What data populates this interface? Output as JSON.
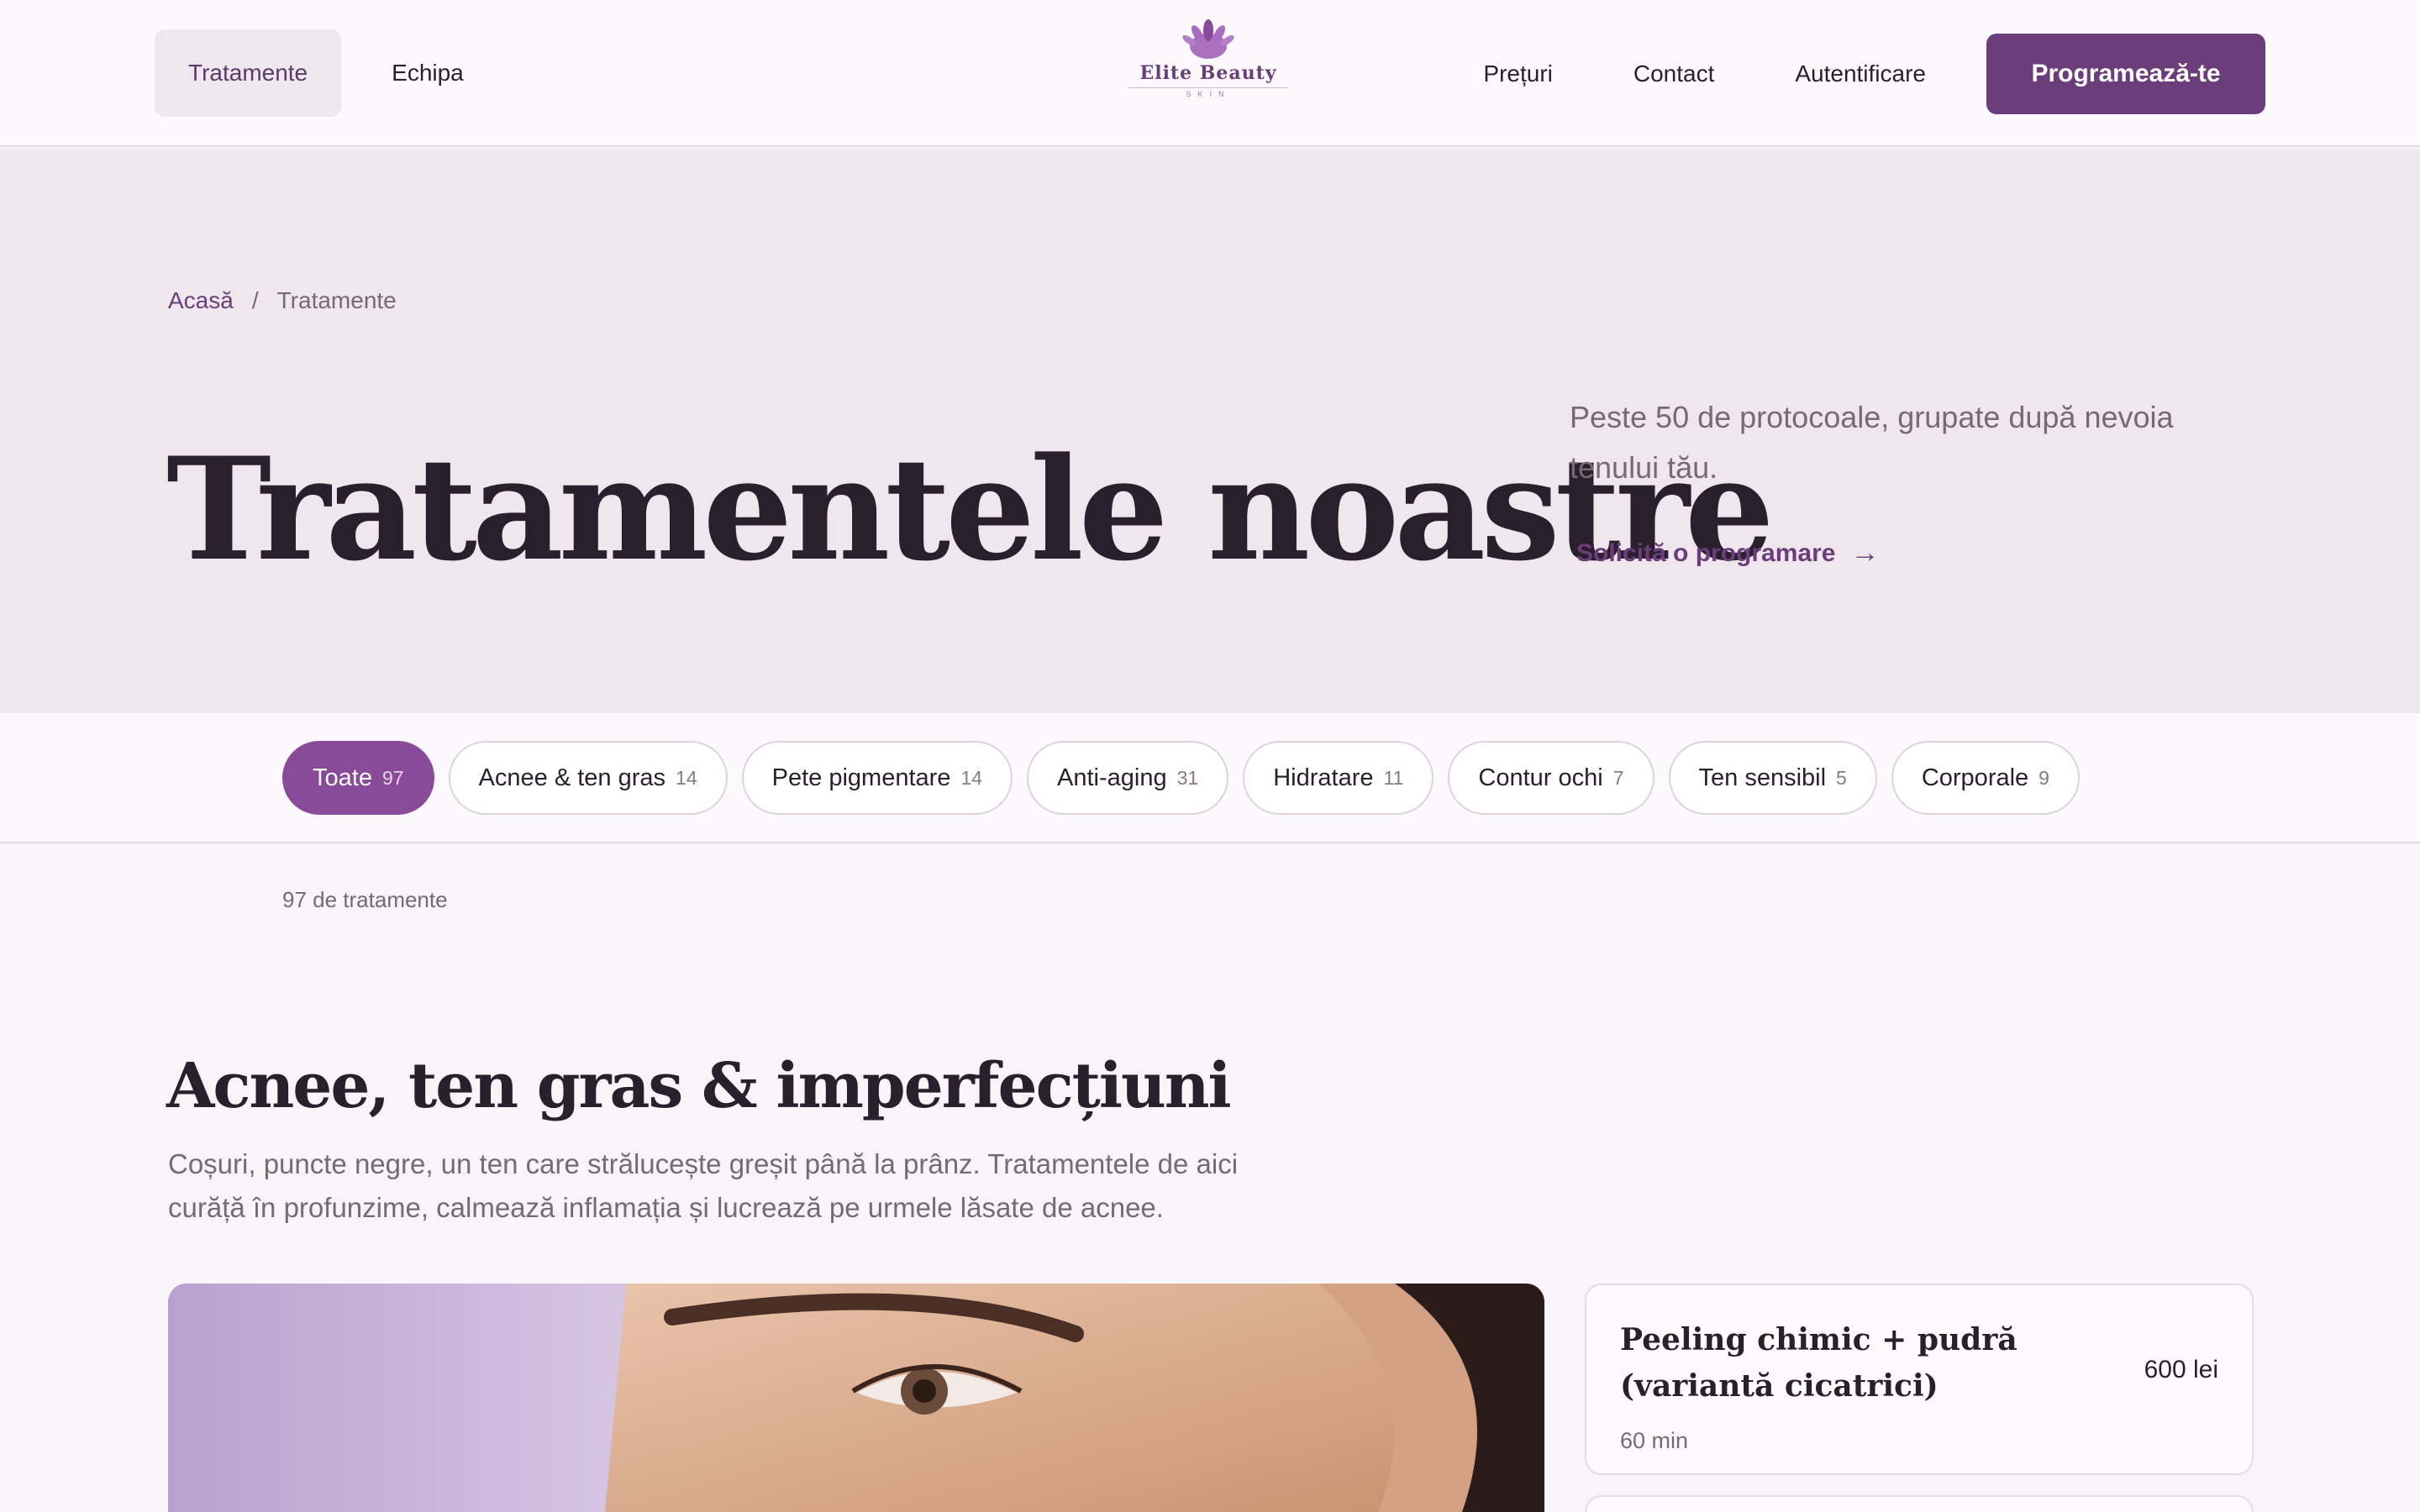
{
  "header": {
    "nav_left": [
      {
        "label": "Tratamente",
        "active": true
      },
      {
        "label": "Echipa",
        "active": false
      }
    ],
    "logo": {
      "name": "Elite Beauty",
      "sub": "SKIN",
      "icon": "lotus-icon"
    },
    "nav_right": [
      "Prețuri",
      "Contact",
      "Autentificare"
    ],
    "cta": "Programează-te"
  },
  "hero": {
    "breadcrumb": {
      "home": "Acasă",
      "separator": "/",
      "current": "Tratamente"
    },
    "title": "Tratamentele noastre",
    "description": "Peste 50 de protocoale, grupate după nevoia tenului tău.",
    "cta": "Solicită o programare",
    "cta_icon": "arrow-right-icon"
  },
  "filters": [
    {
      "label": "Toate",
      "count": "97",
      "active": true
    },
    {
      "label": "Acnee & ten gras",
      "count": "14",
      "active": false
    },
    {
      "label": "Pete pigmentare",
      "count": "14",
      "active": false
    },
    {
      "label": "Anti-aging",
      "count": "31",
      "active": false
    },
    {
      "label": "Hidratare",
      "count": "11",
      "active": false
    },
    {
      "label": "Contur ochi",
      "count": "7",
      "active": false
    },
    {
      "label": "Ten sensibil",
      "count": "5",
      "active": false
    },
    {
      "label": "Corporale",
      "count": "9",
      "active": false
    }
  ],
  "result_count": "97 de tratamente",
  "section": {
    "title": "Acnee, ten gras & imperfecțiuni",
    "description": "Coșuri, puncte negre, un ten care strălucește greșit până la prânz. Tratamentele de aici curăță în profunzime, calmează inflamația și lucrează pe urmele lăsate de acnee.",
    "treatments": [
      {
        "name": "Peeling chimic + pudră (variantă cicatrici)",
        "duration": "60 min",
        "price": "600 lei"
      }
    ]
  },
  "colors": {
    "brand": "#6b3d7a",
    "chip_active": "#8a4a9a",
    "hero_bg": "#f0e6ee",
    "page_bg": "#f8f4f7"
  }
}
